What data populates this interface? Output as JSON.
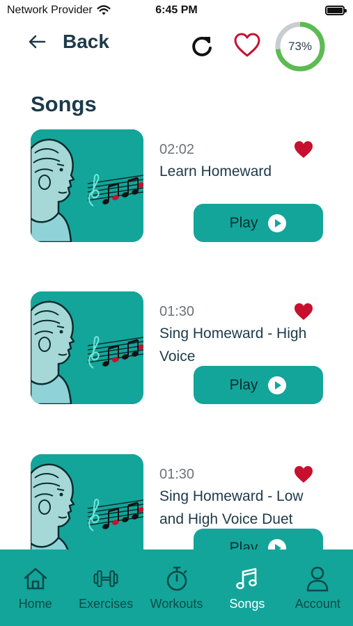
{
  "status_bar": {
    "carrier": "Network Provider",
    "time": "6:45 PM",
    "battery_level": 1.0
  },
  "header": {
    "back_label": "Back",
    "progress_value": 0.73,
    "progress_text": "73%",
    "accent_color": "#13a59a",
    "progress_color": "#5cbb52",
    "favorite_color": "#c8102e"
  },
  "page": {
    "title": "Songs"
  },
  "songs": [
    {
      "duration": "02:02",
      "title": "Learn Homeward",
      "favorited": true,
      "play_label": "Play"
    },
    {
      "duration": "01:30",
      "title": "Sing Homeward - High Voice",
      "favorited": true,
      "play_label": "Play"
    },
    {
      "duration": "01:30",
      "title": "Sing Homeward - Low and High Voice Duet",
      "favorited": true,
      "play_label": "Play"
    }
  ],
  "bottom_nav": {
    "items": [
      {
        "label": "Home",
        "icon": "home-icon",
        "active": false
      },
      {
        "label": "Exercises",
        "icon": "dumbbell-icon",
        "active": false
      },
      {
        "label": "Workouts",
        "icon": "stopwatch-icon",
        "active": false
      },
      {
        "label": "Songs",
        "icon": "music-note-icon",
        "active": true
      },
      {
        "label": "Account",
        "icon": "person-icon",
        "active": false
      }
    ]
  }
}
